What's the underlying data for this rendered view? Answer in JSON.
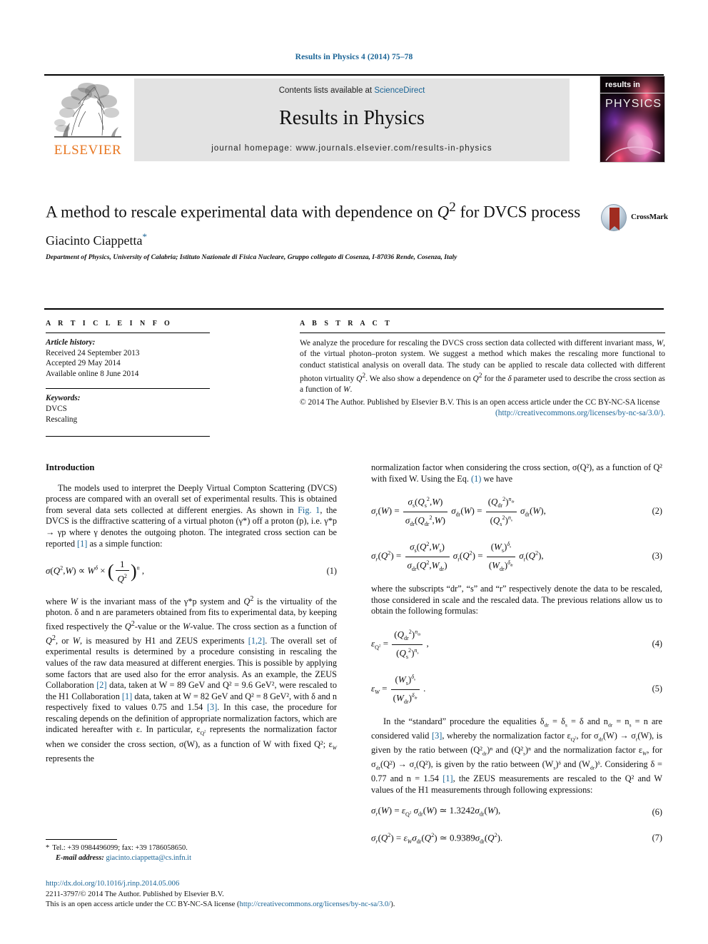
{
  "running_head": "Results in Physics 4 (2014) 75–78",
  "masthead": {
    "contents_prefix": "Contents lists available at ",
    "contents_link": "ScienceDirect",
    "journal_title": "Results in Physics",
    "homepage": "journal homepage: www.journals.elsevier.com/results-in-physics",
    "publisher_logo_word": "ELSEVIER",
    "cover": {
      "line1": "results in",
      "line2": "PHYSICS"
    },
    "accent_link_color": "#3a8ec6",
    "elsevier_orange": "#E87722"
  },
  "article": {
    "title_part1": "A method to rescale experimental data with dependence on ",
    "title_q": "Q",
    "title_sup": "2",
    "title_part2": " for DVCS process",
    "author": "Giacinto Ciappetta",
    "author_mark": "*",
    "affiliation": "Department of Physics, University of Calabria; Istituto Nazionale di Fisica Nucleare, Gruppo collegato di Cosenza, I-87036 Rende, Cosenza, Italy",
    "crossmark_label": "CrossMark"
  },
  "article_info": {
    "heading": "A R T I C L E  I N F O",
    "history_label": "Article history:",
    "received": "Received 24 September 2013",
    "accepted": "Accepted 29 May 2014",
    "available": "Available online 8 June 2014",
    "keywords_label": "Keywords:",
    "keywords": [
      "DVCS",
      "Rescaling"
    ]
  },
  "abstract": {
    "heading": "A B S T R A C T",
    "text_a": "We analyze the procedure for rescaling the DVCS cross section data collected with different invariant mass, ",
    "text_b": ", of the virtual photon–proton system. We suggest a method which makes the rescaling more functional to conduct statistical analysis on overall data. The study can be applied to rescale data collected with different photon virtuality ",
    "text_c": ". We also show a dependence on ",
    "text_d": " for the ",
    "text_e": " parameter used to describe the cross section as a function of ",
    "text_f": ".",
    "copyright": "© 2014 The Author. Published by Elsevier B.V. This is an open access article under the CC BY-NC-SA license",
    "license_url": "(http://creativecommons.org/licenses/by-nc-sa/3.0/)."
  },
  "body": {
    "intro_heading": "Introduction",
    "p1_a": "The models used to interpret the Deeply Virtual Compton Scattering (DVCS) process are compared with an overall set of experimental results. This is obtained from several data sets collected at different energies. As shown in ",
    "p1_figref": "Fig. 1",
    "p1_b": ", the DVCS is the diffractive scattering of a virtual photon (γ*) off a proton (p), i.e. γ*p → γp where γ denotes the outgoing photon. The integrated cross section can be reported ",
    "p1_ref": "[1]",
    "p1_c": " as a simple function:",
    "p2_a": "where ",
    "p2_b": " is the invariant mass of the γ*p system and ",
    "p2_c": " is the virtuality of the photon. δ and n are parameters obtained from fits to experimental data, by keeping fixed respectively the ",
    "p2_d": "-value or the ",
    "p2_e": "-value. The cross section as a function of ",
    "p2_f": ", or ",
    "p2_g": ", is measured by H1 and ZEUS experiments ",
    "p2_ref12": "[1,2]",
    "p2_h": ". The overall set of experimental results is determined by a procedure consisting in rescaling the values of the raw data measured at different energies. This is possible by applying some factors that are used also for the error analysis. As an example, the ZEUS Collaboration ",
    "p2_ref2": "[2]",
    "p2_i": " data, taken at W = 89 GeV and Q² = 9.6 GeV², were rescaled to the H1 Collaboration ",
    "p2_ref1": "[1]",
    "p2_j": " data, taken at W = 82 GeV and Q² = 8 GeV², with δ and n respectively fixed to values 0.75 and 1.54 ",
    "p2_ref3": "[3]",
    "p2_k": ". In this case, the procedure for rescaling depends on the definition of appropriate normalization factors, which are indicated hereafter with ε. In particular, ε",
    "p2_l": " represents the normalization factor when we consider the cross section, σ(W), as a function of W with fixed Q²; ε",
    "p2_m": " represents the",
    "r_p1_a": "normalization factor when considering the cross section, σ(Q²), as a function of Q² with fixed W. Using the Eq. ",
    "r_p1_ref": "(1)",
    "r_p1_b": " we have",
    "r_p2": "where the subscripts “dr”, “s” and “r” respectively denote the data to be rescaled, those considered in scale and the rescaled data. The previous relations allow us to obtain the following formulas:",
    "r_p3_a": "In the “standard” procedure the equalities δ",
    "r_p3_b": " = δ",
    "r_p3_c": " = δ and n",
    "r_p3_d": " = n",
    "r_p3_e": " = n are considered valid ",
    "r_p3_ref3": "[3]",
    "r_p3_f": ", whereby the normalization factor ε",
    "r_p3_g": ", for σ",
    "r_p3_h": "(W) → σ",
    "r_p3_i": "(W), is given by the ratio between (Q²",
    "r_p3_j": ")ⁿ and (Q²",
    "r_p3_k": ")ⁿ and the normalization factor ε",
    "r_p3_l": ", for σ",
    "r_p3_m": "(Q²) → σ",
    "r_p3_n": "(Q²), is given by the ratio between (W",
    "r_p3_o": ")ᵟ and (W",
    "r_p3_p": ")ᵟ. Considering δ = 0.77 and n = 1.54 ",
    "r_p3_ref1": "[1]",
    "r_p3_q": ", the ZEUS measurements are rescaled to the Q² and W values of the H1 measurements through following expressions:"
  },
  "equations": {
    "n1": "(1)",
    "n2": "(2)",
    "n3": "(3)",
    "n4": "(4)",
    "n5": "(5)",
    "n6": "(6)",
    "n7": "(7)",
    "eq6_value": "1.3242",
    "eq7_value": "0.9389"
  },
  "footnote": {
    "star": "*",
    "tel": "Tel.: +39 0984496099; fax: +39 1786058650.",
    "email_label": "E-mail address:",
    "email": "giacinto.ciappetta@cs.infn.it"
  },
  "colophon": {
    "doi": "http://dx.doi.org/10.1016/j.rinp.2014.05.006",
    "issn_line": "2211-3797/© 2014 The Author. Published by Elsevier B.V.",
    "license_pre": "This is an open access article under the CC BY-NC-SA license (",
    "license_url": "http://creativecommons.org/licenses/by-nc-sa/3.0/",
    "license_post": ")."
  }
}
